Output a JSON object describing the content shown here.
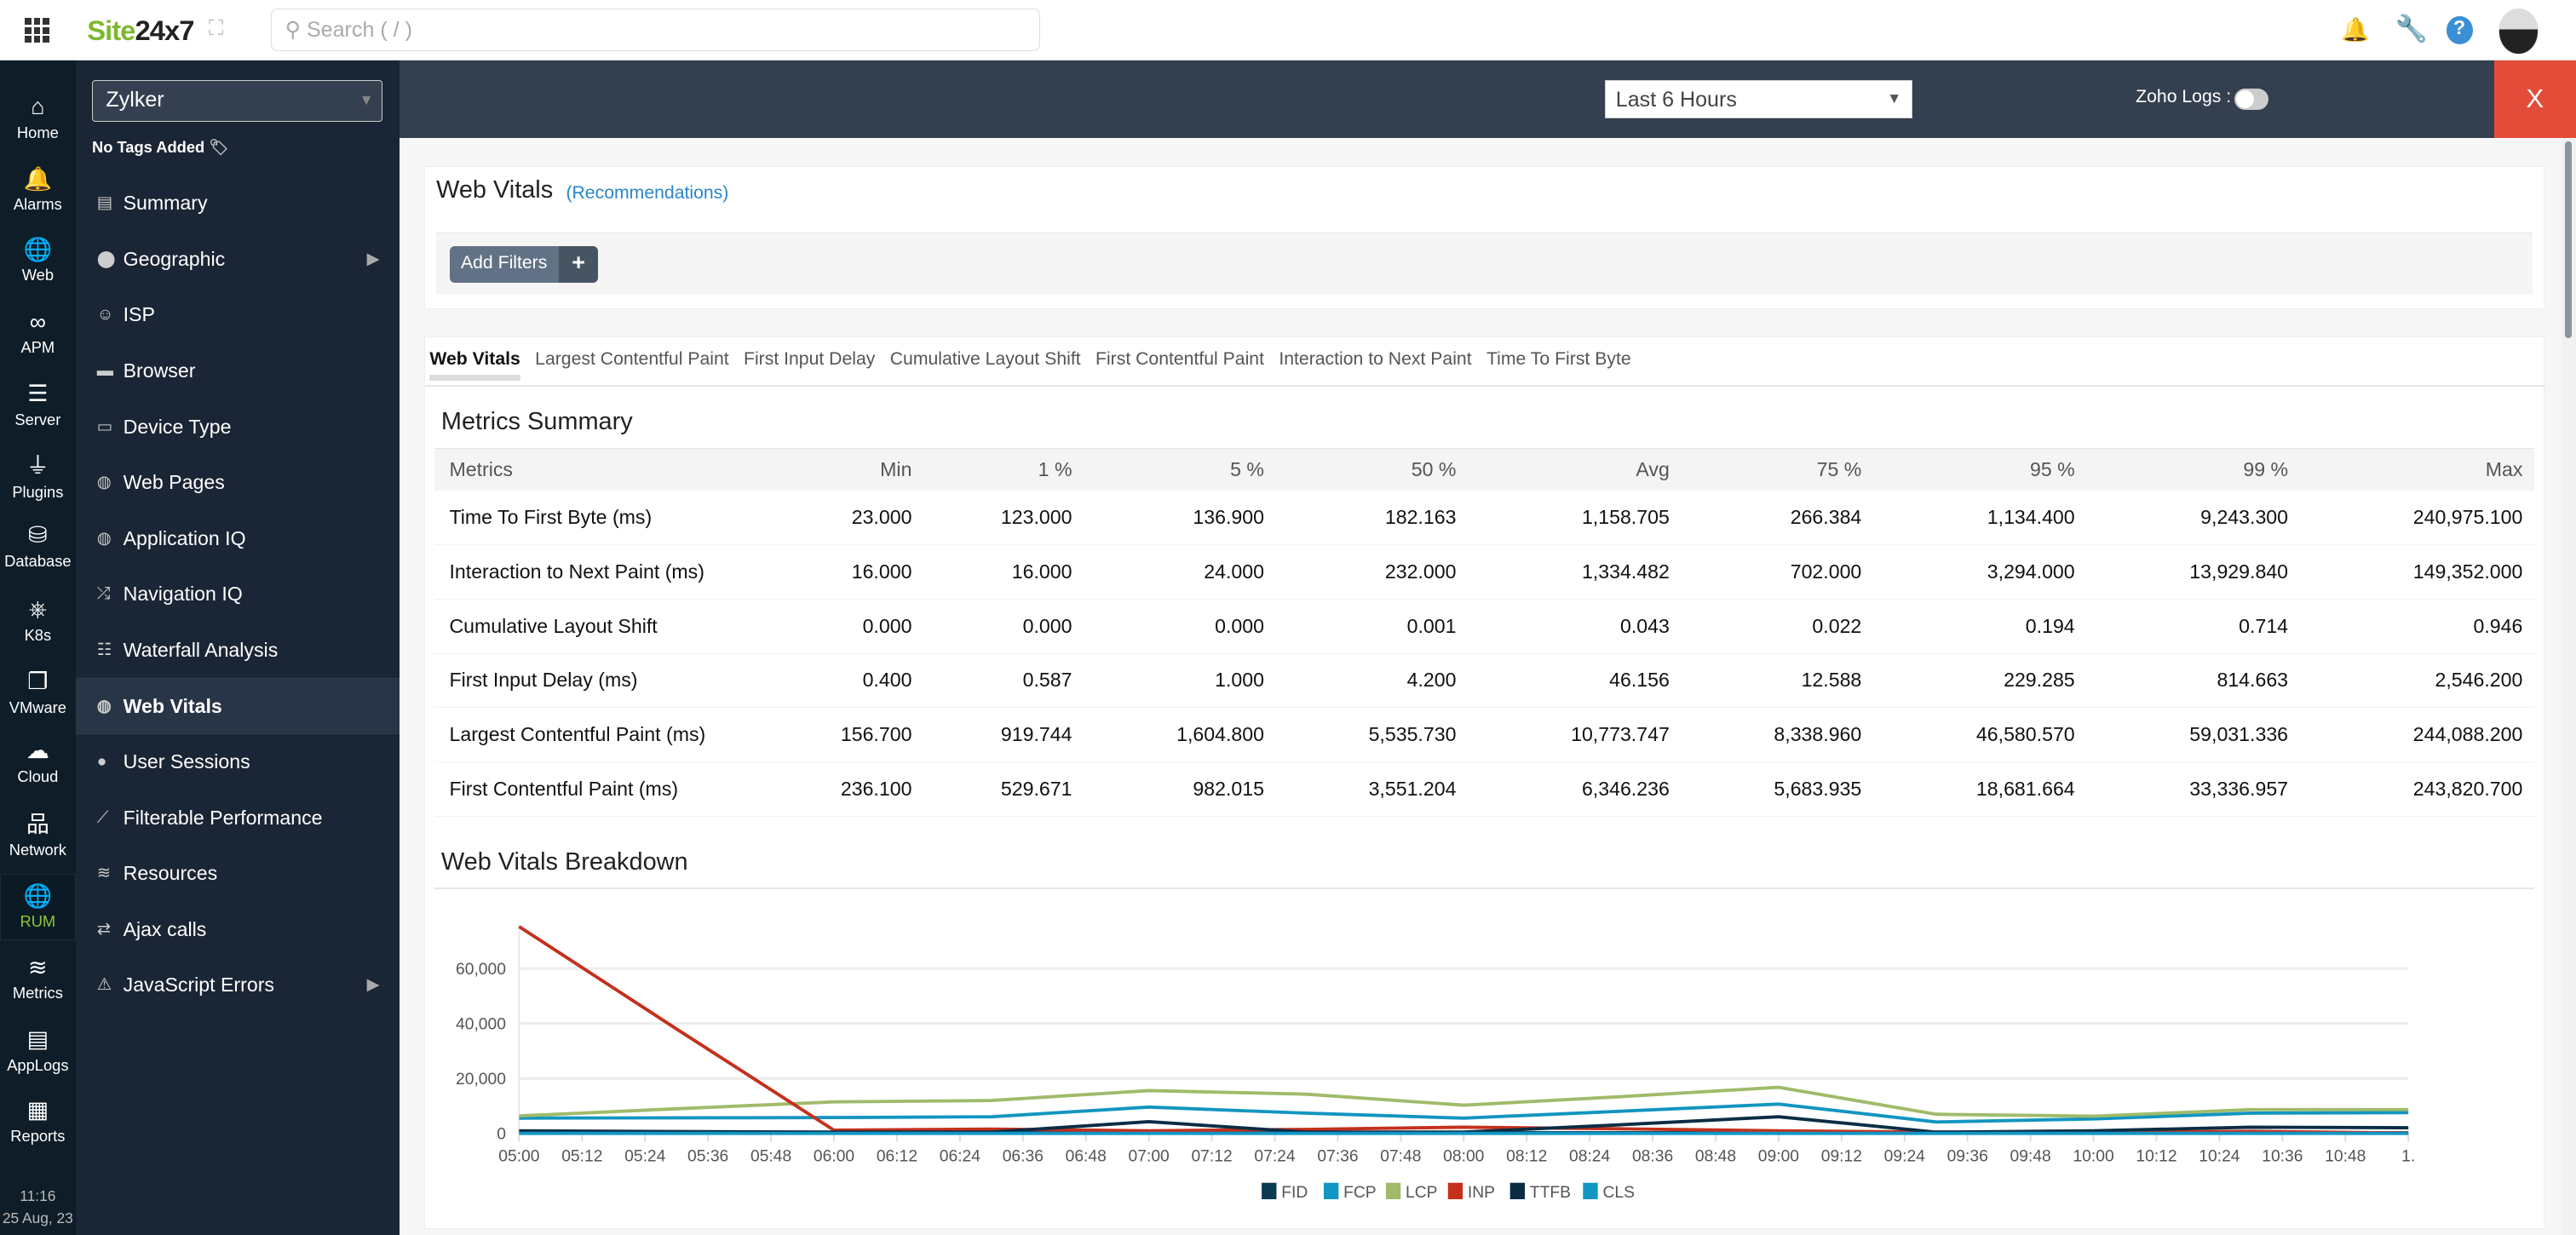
{
  "topbar": {
    "logo_green": "Site",
    "logo_dark": "24x7",
    "search_placeholder": "Search ( / )",
    "icons": [
      "apps-grid-icon",
      "expand-icon",
      "notification-icon",
      "wrench-icon",
      "help-icon",
      "avatar"
    ]
  },
  "rail": [
    {
      "label": "Home",
      "icon": "⌂"
    },
    {
      "label": "Alarms",
      "icon": "🔔"
    },
    {
      "label": "Web",
      "icon": "🌐"
    },
    {
      "label": "APM",
      "icon": "∞"
    },
    {
      "label": "Server",
      "icon": "☰"
    },
    {
      "label": "Plugins",
      "icon": "⏚"
    },
    {
      "label": "Database",
      "icon": "⛁"
    },
    {
      "label": "K8s",
      "icon": "⎈"
    },
    {
      "label": "VMware",
      "icon": "❐"
    },
    {
      "label": "Cloud",
      "icon": "☁"
    },
    {
      "label": "Network",
      "icon": "品"
    },
    {
      "label": "RUM",
      "icon": "🌐",
      "active": true
    },
    {
      "label": "Metrics",
      "icon": "≋"
    },
    {
      "label": "AppLogs",
      "icon": "▤"
    },
    {
      "label": "Reports",
      "icon": "▦"
    }
  ],
  "rail_time": "11:16",
  "rail_date": "25 Aug, 23",
  "sidebar": {
    "site": "Zylker",
    "tags": "No Tags Added",
    "items": [
      {
        "label": "Summary",
        "icon": "▤"
      },
      {
        "label": "Geographic",
        "icon": "⬤",
        "arrow": true
      },
      {
        "label": "ISP",
        "icon": "☺"
      },
      {
        "label": "Browser",
        "icon": "▬"
      },
      {
        "label": "Device Type",
        "icon": "▭"
      },
      {
        "label": "Web Pages",
        "icon": "◍"
      },
      {
        "label": "Application IQ",
        "icon": "◍"
      },
      {
        "label": "Navigation IQ",
        "icon": "⤮"
      },
      {
        "label": "Waterfall Analysis",
        "icon": "☷"
      },
      {
        "label": "Web Vitals",
        "icon": "◍",
        "active": true
      },
      {
        "label": "User Sessions",
        "icon": "●"
      },
      {
        "label": "Filterable Performance",
        "icon": "⟋"
      },
      {
        "label": "Resources",
        "icon": "≋"
      },
      {
        "label": "Ajax calls",
        "icon": "⇄"
      },
      {
        "label": "JavaScript Errors",
        "icon": "⚠",
        "arrow": true
      }
    ]
  },
  "header": {
    "period": "Last 6 Hours",
    "zoho_logs": "Zoho Logs :",
    "zoho_logs_on": false,
    "close": "X"
  },
  "page": {
    "title": "Web Vitals",
    "recommendations": "(Recommendations)",
    "add_filters": "Add Filters",
    "plus": "+"
  },
  "tabs": [
    "Web Vitals",
    "Largest Contentful Paint",
    "First Input Delay",
    "Cumulative Layout Shift",
    "First Contentful Paint",
    "Interaction to Next Paint",
    "Time To First Byte"
  ],
  "summary": {
    "title": "Metrics Summary",
    "headers": [
      "Metrics",
      "Min",
      "1 %",
      "5 %",
      "50 %",
      "Avg",
      "75 %",
      "95 %",
      "99 %",
      "Max"
    ],
    "rows": [
      [
        "Time To First Byte (ms)",
        "23.000",
        "123.000",
        "136.900",
        "182.163",
        "1,158.705",
        "266.384",
        "1,134.400",
        "9,243.300",
        "240,975.100"
      ],
      [
        "Interaction to Next Paint (ms)",
        "16.000",
        "16.000",
        "24.000",
        "232.000",
        "1,334.482",
        "702.000",
        "3,294.000",
        "13,929.840",
        "149,352.000"
      ],
      [
        "Cumulative Layout Shift",
        "0.000",
        "0.000",
        "0.000",
        "0.001",
        "0.043",
        "0.022",
        "0.194",
        "0.714",
        "0.946"
      ],
      [
        "First Input Delay (ms)",
        "0.400",
        "0.587",
        "1.000",
        "4.200",
        "46.156",
        "12.588",
        "229.285",
        "814.663",
        "2,546.200"
      ],
      [
        "Largest Contentful Paint (ms)",
        "156.700",
        "919.744",
        "1,604.800",
        "5,535.730",
        "10,773.747",
        "8,338.960",
        "46,580.570",
        "59,031.336",
        "244,088.200"
      ],
      [
        "First Contentful Paint (ms)",
        "236.100",
        "529.671",
        "982.015",
        "3,551.204",
        "6,346.236",
        "5,683.935",
        "18,681.664",
        "33,336.957",
        "243,820.700"
      ]
    ]
  },
  "chart_data": {
    "type": "line",
    "title": "Web Vitals Breakdown",
    "x": [
      "05:00",
      "05:30",
      "06:00",
      "06:30",
      "07:00",
      "07:30",
      "08:00",
      "08:30",
      "09:00",
      "09:30",
      "10:00",
      "10:30",
      "11:00"
    ],
    "x_ticks": [
      "05:00",
      "05:12",
      "05:24",
      "05:36",
      "05:48",
      "06:00",
      "06:12",
      "06:24",
      "06:36",
      "06:48",
      "07:00",
      "07:12",
      "07:24",
      "07:36",
      "07:48",
      "08:00",
      "08:12",
      "08:24",
      "08:36",
      "08:48",
      "09:00",
      "09:12",
      "09:24",
      "09:36",
      "09:48",
      "10:00",
      "10:12",
      "10:24",
      "10:36",
      "10:48",
      "1."
    ],
    "y_ticks": [
      0,
      20000,
      40000,
      60000
    ],
    "ylim": [
      0,
      75000
    ],
    "grid": true,
    "legend": "bottom",
    "series": [
      {
        "name": "FID",
        "color": "#0b3a53",
        "values": [
          300,
          300,
          300,
          300,
          300,
          300,
          300,
          300,
          300,
          300,
          300,
          300,
          300
        ]
      },
      {
        "name": "FCP",
        "color": "#1295c0",
        "values": [
          5600,
          5700,
          5800,
          6100,
          9600,
          7400,
          5600,
          8100,
          10700,
          4200,
          5300,
          7400,
          7600
        ]
      },
      {
        "name": "LCP",
        "color": "#9fbb6a",
        "values": [
          6400,
          9000,
          11500,
          12000,
          15600,
          14300,
          10300,
          13400,
          16800,
          7000,
          6300,
          8700,
          8700
        ]
      },
      {
        "name": "INP",
        "color": "#c4301c",
        "values": [
          75200,
          38000,
          1200,
          1600,
          1000,
          1500,
          2300,
          1700,
          1000,
          500,
          400,
          800,
          200
        ]
      },
      {
        "name": "TTFB",
        "color": "#0a2d44",
        "values": [
          1000,
          700,
          500,
          500,
          4300,
          500,
          500,
          3200,
          6100,
          500,
          1000,
          2300,
          2100
        ]
      },
      {
        "name": "CLS",
        "color": "#1296c4",
        "values": [
          50,
          50,
          50,
          50,
          50,
          50,
          50,
          50,
          50,
          50,
          50,
          50,
          50
        ]
      }
    ]
  }
}
